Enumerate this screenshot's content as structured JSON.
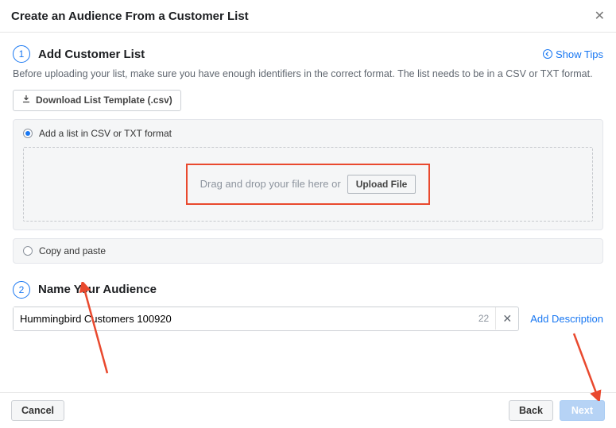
{
  "dialog": {
    "title": "Create an Audience From a Customer List"
  },
  "step1": {
    "number": "1",
    "title": "Add Customer List",
    "showTipsLabel": "Show Tips",
    "helper": "Before uploading your list, make sure you have enough identifiers in the correct format. The list needs to be in a CSV or TXT format.",
    "downloadTemplateLabel": "Download List Template (.csv)",
    "uploadOption": {
      "label": "Add a list in CSV or TXT format",
      "dragText": "Drag and drop your file here or",
      "uploadButton": "Upload File"
    },
    "pasteOption": {
      "label": "Copy and paste"
    }
  },
  "step2": {
    "number": "2",
    "title": "Name Your Audience",
    "input": {
      "value": "Hummingbird Customers 100920",
      "charCount": "22"
    },
    "addDescription": "Add Description"
  },
  "footer": {
    "cancel": "Cancel",
    "back": "Back",
    "next": "Next"
  }
}
